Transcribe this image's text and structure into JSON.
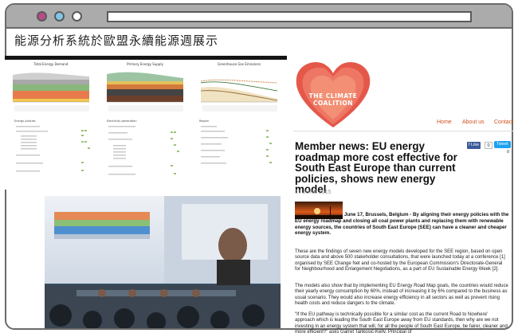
{
  "page": {
    "heading": "能源分析系統於歐盟永續能源週展示"
  },
  "dashboard": {
    "chart_titles": [
      "Total Energy Demand",
      "Primary Energy Supply",
      "Greenhouse Gas Emissions"
    ],
    "panel_titles": [
      "Energy policies",
      "Electricity generation",
      "Region"
    ]
  },
  "site": {
    "logo_text": "THE CLIMATE COALITION",
    "nav": [
      "Home",
      "About us",
      "Contact"
    ],
    "share": {
      "fb_label": "f Like",
      "fb_count": "0",
      "tw_label": "Tweet",
      "tw_count": "0"
    }
  },
  "article": {
    "title": "Member news: EU energy roadmap more cost effective for South East Europe than current policies, shows new energy model",
    "date": "17 JUNE 2015",
    "lead": "June 17, Brussels, Belgium - By aligning their energy policies with the EU energy roadmap and closing all coal power plants and replacing them with renewable energy sources, the countries of South East Europe (SEE) can have a cleaner and cheaper energy system.",
    "p1": "These are the findings of seven new energy models developed for the SEE region, based on open source data and above 500 stakeholder consultations, that were launched today at a conference [1] organised by SEE Change Net and co-hosted by the European Commission's Directorate-General for Neighbourhood and Enlargement Negotiations, as a part of EU Sustainable Energy Week [2].",
    "p2": "The models also show that by implementing EU Energy Road Map goals, the countries would reduce their yearly energy consumption by 60%, instead of increasing it by 6% compared to the business as usual scenario. They would also increase energy efficiency in all sectors as well as prevent rising health costs and reduce dangers to the climate.",
    "p3": "\"If the EU pathway is technically possible for a similar cost as the current Road to Nowhere' approach which is leading the South East Europe away from EU standards, then why are we not investing in an energy system that will, for all the people of South East Europe, be fairer, cleaner and more efficient?\" asks Garret Tankosić-Kelly, Principal of"
  },
  "colors": {
    "accent": "#d05020",
    "heart": "#e4584a",
    "brand": "#f07e6a"
  }
}
